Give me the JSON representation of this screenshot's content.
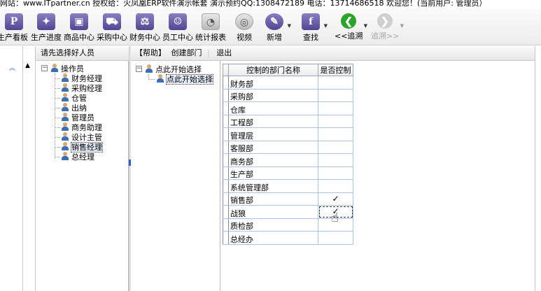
{
  "title_bar": {
    "text": "网站：www.ITpartner.cn  授权给：火凤凰ERP软件演示帐套 演示预约QQ:1308472189  电话：13714686518  欢迎您！(当前用户: 管理员）"
  },
  "toolbar": {
    "buttons": [
      {
        "label": "生产看板",
        "icon": "P"
      },
      {
        "label": "生产进度",
        "icon": "✦"
      },
      {
        "label": "商品中心",
        "icon": "▣"
      },
      {
        "label": "采购中心",
        "icon": "⛟"
      },
      {
        "label": "财务中心",
        "icon": "⚖"
      },
      {
        "label": "员工中心",
        "icon": "☺"
      },
      {
        "label": "统计报表",
        "icon": "◔"
      },
      {
        "label": "视频",
        "icon": "◎"
      },
      {
        "label": "新增",
        "icon": "✎"
      },
      {
        "label": "查找",
        "icon": "f"
      },
      {
        "label": "<<追溯",
        "icon": "❮"
      },
      {
        "label": "追溯>>",
        "icon": "❯"
      }
    ]
  },
  "staff_panel": {
    "header": "请先选择好人员",
    "tree": {
      "root": "操作员",
      "children": [
        "财务经理",
        "采购经理",
        "仓管",
        "出纳",
        "管理员",
        "商务助理",
        "设计主管",
        "销售经理",
        "总经理"
      ],
      "selected": "销售经理"
    }
  },
  "dept_menu": {
    "help": "【帮助】",
    "create_dept": "创建部门",
    "exit": "退出"
  },
  "dept_tree": {
    "root": "点此开始选择",
    "child": "点此开始选择"
  },
  "grid": {
    "columns": [
      "控制的部门名称",
      "是否控制"
    ],
    "rows": [
      {
        "name": "财务部",
        "control": ""
      },
      {
        "name": "采购部",
        "control": ""
      },
      {
        "name": "仓库",
        "control": ""
      },
      {
        "name": "工程部",
        "control": ""
      },
      {
        "name": "管理层",
        "control": ""
      },
      {
        "name": "客服部",
        "control": ""
      },
      {
        "name": "商务部",
        "control": ""
      },
      {
        "name": "生产部",
        "control": ""
      },
      {
        "name": "系统管理部",
        "control": ""
      },
      {
        "name": "销售部",
        "control": "✓"
      },
      {
        "name": "战狼",
        "control": "✓"
      },
      {
        "name": "质检部",
        "control": ""
      },
      {
        "name": "总经办",
        "control": ""
      }
    ]
  }
}
